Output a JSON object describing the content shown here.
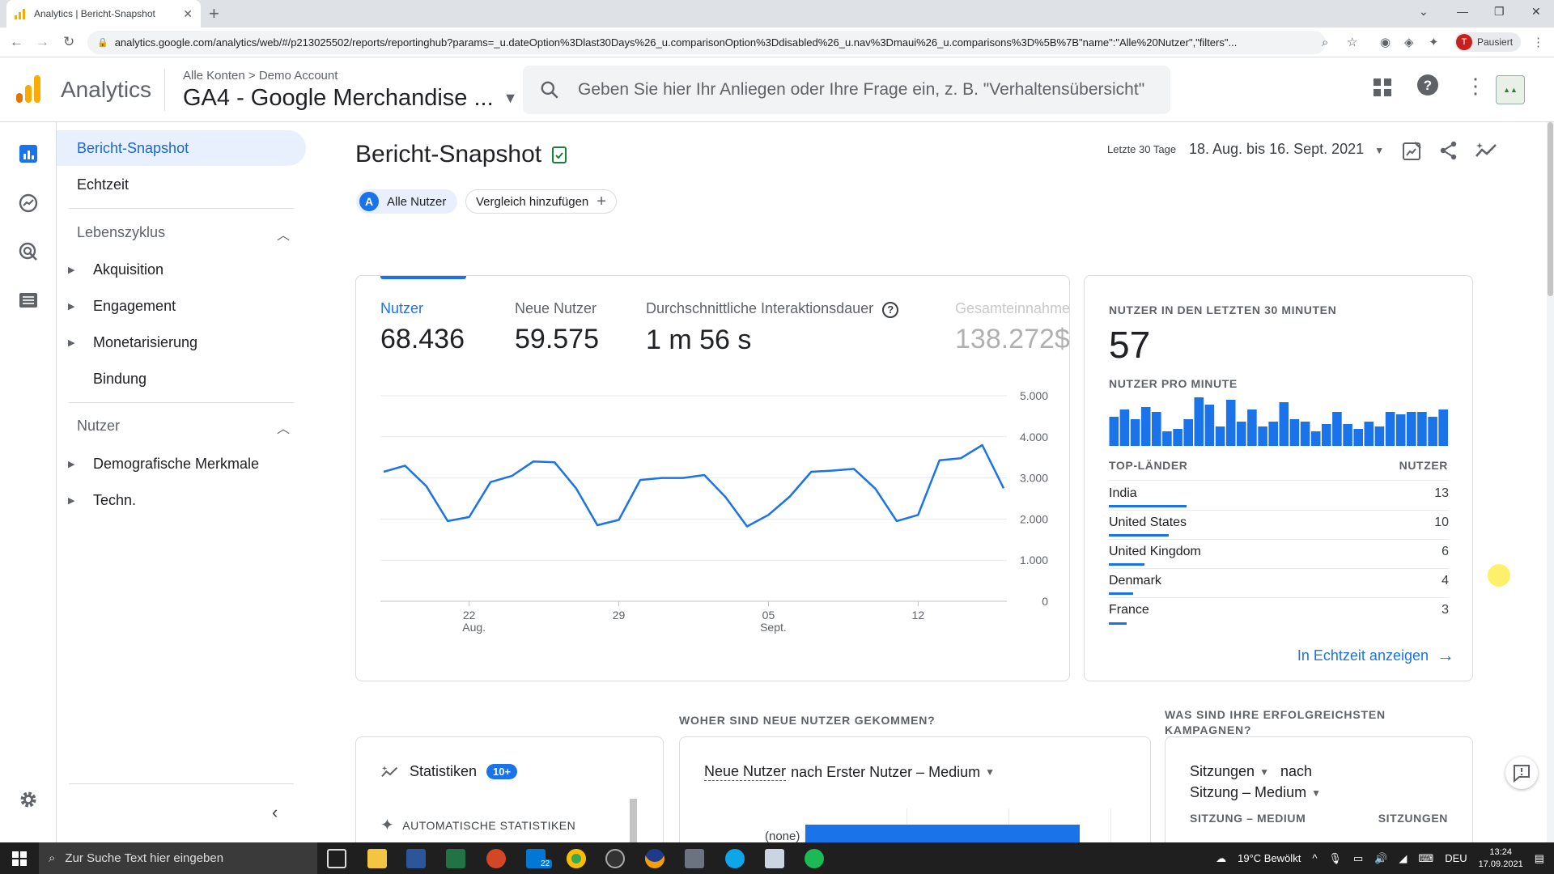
{
  "browser": {
    "tab_title": "Analytics | Bericht-Snapshot",
    "url": "analytics.google.com/analytics/web/#/p213025502/reports/reportinghub?params=_u.dateOption%3Dlast30Days%26_u.comparisonOption%3Ddisabled%26_u.nav%3Dmaui%26_u.comparisons%3D%5B%7B\"name\":\"Alle%20Nutzer\",\"filters\"...",
    "profile_initial": "T",
    "profile_label": "Pausiert"
  },
  "header": {
    "app_name": "Analytics",
    "crumb_all": "Alle Konten",
    "crumb_account": "Demo Account",
    "property": "GA4 - Google Merchandise ...",
    "search_placeholder": "Geben Sie hier Ihr Anliegen oder Ihre Frage ein, z. B. \"Verhaltensübersicht\""
  },
  "nav": {
    "snapshot": "Bericht-Snapshot",
    "realtime": "Echtzeit",
    "lifecycle": "Lebenszyklus",
    "acquisition": "Akquisition",
    "engagement": "Engagement",
    "monetization": "Monetarisierung",
    "retention": "Bindung",
    "users": "Nutzer",
    "demographics": "Demografische Merkmale",
    "tech": "Techn."
  },
  "page": {
    "title": "Bericht-Snapshot",
    "segment_letter": "A",
    "segment": "Alle Nutzer",
    "add_comparison": "Vergleich hinzufügen",
    "range_label": "Letzte 30 Tage",
    "range": "18. Aug. bis 16. Sept. 2021"
  },
  "metrics": [
    {
      "label": "Nutzer",
      "value": "68.436"
    },
    {
      "label": "Neue Nutzer",
      "value": "59.575"
    },
    {
      "label": "Durchschnittliche Interaktionsdauer",
      "value": "1 m 56 s"
    },
    {
      "label": "Gesamteinnahmen",
      "value": "138.272$"
    }
  ],
  "chart_data": {
    "type": "line",
    "y_ticks": [
      "5.000",
      "4.000",
      "3.000",
      "2.000",
      "1.000",
      "0"
    ],
    "ylim": [
      0,
      5000
    ],
    "x_ticks": [
      {
        "day": "22",
        "month": "Aug."
      },
      {
        "day": "29",
        "month": ""
      },
      {
        "day": "05",
        "month": "Sept."
      },
      {
        "day": "12",
        "month": ""
      }
    ],
    "x": [
      "18.08",
      "19.08",
      "20.08",
      "21.08",
      "22.08",
      "23.08",
      "24.08",
      "25.08",
      "26.08",
      "27.08",
      "28.08",
      "29.08",
      "30.08",
      "31.08",
      "01.09",
      "02.09",
      "03.09",
      "04.09",
      "05.09",
      "06.09",
      "07.09",
      "08.09",
      "09.09",
      "10.09",
      "11.09",
      "12.09",
      "13.09",
      "14.09",
      "15.09",
      "16.09"
    ],
    "series": [
      {
        "values": [
          3150,
          3300,
          2800,
          1950,
          2050,
          2900,
          3050,
          3400,
          3380,
          2750,
          1850,
          1980,
          2950,
          3000,
          3000,
          3070,
          2530,
          1820,
          2100,
          2550,
          3150,
          3180,
          3220,
          2740,
          1950,
          2100,
          3430,
          3480,
          3800,
          2750
        ]
      }
    ]
  },
  "realtime": {
    "title": "NUTZER IN DEN LETZTEN 30 MINUTEN",
    "value": "57",
    "per_minute": "NUTZER PRO MINUTE",
    "bars": [
      0.6,
      0.75,
      0.55,
      0.8,
      0.7,
      0.3,
      0.35,
      0.55,
      1.0,
      0.85,
      0.4,
      0.95,
      0.5,
      0.75,
      0.4,
      0.5,
      0.9,
      0.55,
      0.5,
      0.3,
      0.45,
      0.7,
      0.45,
      0.35,
      0.5,
      0.4,
      0.7,
      0.65,
      0.7,
      0.7,
      0.6,
      0.75
    ],
    "col_countries": "TOP-LÄNDER",
    "col_users": "NUTZER",
    "countries": [
      {
        "name": "India",
        "value": "13",
        "share": 1.0
      },
      {
        "name": "United States",
        "value": "10",
        "share": 0.77
      },
      {
        "name": "United Kingdom",
        "value": "6",
        "share": 0.46
      },
      {
        "name": "Denmark",
        "value": "4",
        "share": 0.31
      },
      {
        "name": "France",
        "value": "3",
        "share": 0.23
      }
    ],
    "link": "In Echtzeit anzeigen"
  },
  "bottom": {
    "section_new_users": "WOHER SIND NEUE NUTZER GEKOMMEN?",
    "section_campaigns": "WAS SIND IHRE ERFOLGREICHSTEN KAMPAGNEN?",
    "insights": "Statistiken",
    "insights_badge": "10+",
    "auto_insights": "AUTOMATISCHE STATISTIKEN",
    "new_users_metric": "Neue Nutzer",
    "new_users_dim": "nach Erster Nutzer – Medium",
    "none_label": "(none)",
    "sessions_metric": "Sitzungen",
    "sessions_by": "nach",
    "sessions_dim": "Sitzung – Medium",
    "col_medium": "SITZUNG – MEDIUM",
    "col_sessions": "SITZUNGEN"
  },
  "taskbar": {
    "search": "Zur Suche Text hier eingeben",
    "mail_badge": "22",
    "weather": "19°C  Bewölkt",
    "lang": "DEU",
    "time": "13:24",
    "date": "17.09.2021"
  },
  "colors": {
    "accent": "#1a73e8",
    "logo_orange": "#f9ab00",
    "logo_dark": "#e37400"
  }
}
